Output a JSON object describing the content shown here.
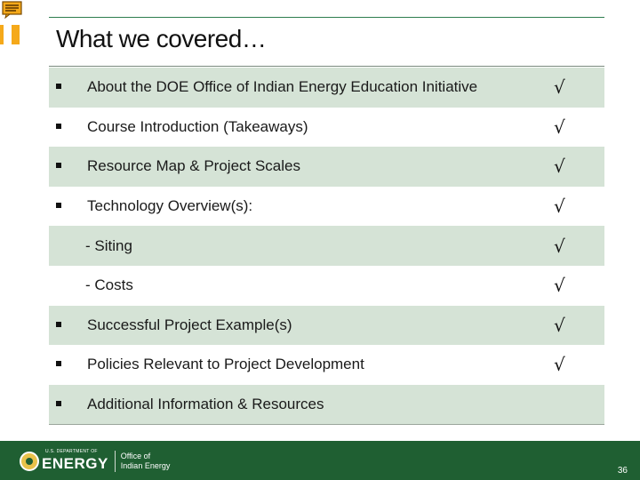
{
  "title": "What we covered…",
  "rows": [
    {
      "label": " About the DOE Office of Indian Energy Education Initiative",
      "bullet": true,
      "check": "√",
      "shaded": true
    },
    {
      "label": "Course Introduction (Takeaways)",
      "bullet": true,
      "check": "√",
      "shaded": false
    },
    {
      "label": "Resource Map & Project Scales",
      "bullet": true,
      "check": "√",
      "shaded": true
    },
    {
      "label": "Technology Overview(s):",
      "bullet": true,
      "check": "√",
      "shaded": false
    },
    {
      "label": "- Siting",
      "bullet": false,
      "check": "√",
      "shaded": true
    },
    {
      "label": "- Costs",
      "bullet": false,
      "check": "√",
      "shaded": false
    },
    {
      "label": "Successful Project Example(s)",
      "bullet": true,
      "check": "√",
      "shaded": true
    },
    {
      "label": "Policies Relevant to Project Development",
      "bullet": true,
      "check": "√",
      "shaded": false
    },
    {
      "label": "Additional Information & Resources",
      "bullet": true,
      "check": "",
      "shaded": true
    }
  ],
  "footer": {
    "dept": "U.S. DEPARTMENT OF",
    "energy": "ENERGY",
    "office_line1": "Office of",
    "office_line2": "Indian Energy",
    "page_number": "36"
  },
  "icons": {
    "comment": "comment-icon",
    "seal": "doe-seal-icon"
  },
  "colors": {
    "footer": "#1f5f32",
    "row_shade": "#d5e3d6",
    "accent": "#f5a91a"
  }
}
